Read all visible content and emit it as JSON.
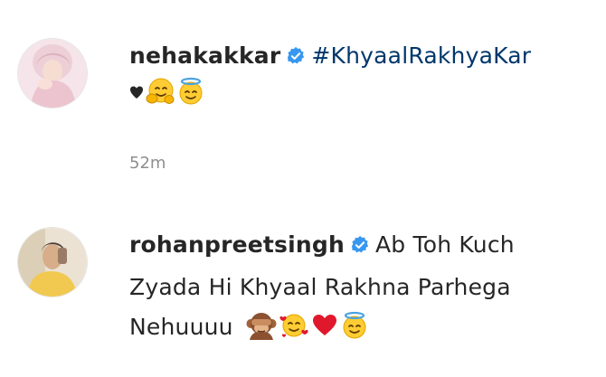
{
  "comments": [
    {
      "username": "nehakakkar",
      "verified": true,
      "hashtag": "#KhyaalRakhyaKar",
      "emojis": [
        "black-heart-icon",
        "hugging-face-icon",
        "smiling-face-with-halo-icon"
      ],
      "timestamp": "52m"
    },
    {
      "username": "rohanpreetsingh",
      "verified": true,
      "text_line1": "Ab Toh Kuch",
      "text_line2": "Zyada Hi Khyaal Rakhna Parhega",
      "text_line3": "Nehuuuu",
      "emojis": [
        "see-no-evil-monkey-icon",
        "smiling-face-with-hearts-icon",
        "red-heart-icon",
        "smiling-face-with-halo-icon"
      ]
    }
  ],
  "colors": {
    "text": "#262626",
    "hashtag": "#00376b",
    "verified": "#3897f0",
    "timestamp": "#8e8e8e",
    "heart_red": "#e0182d"
  }
}
